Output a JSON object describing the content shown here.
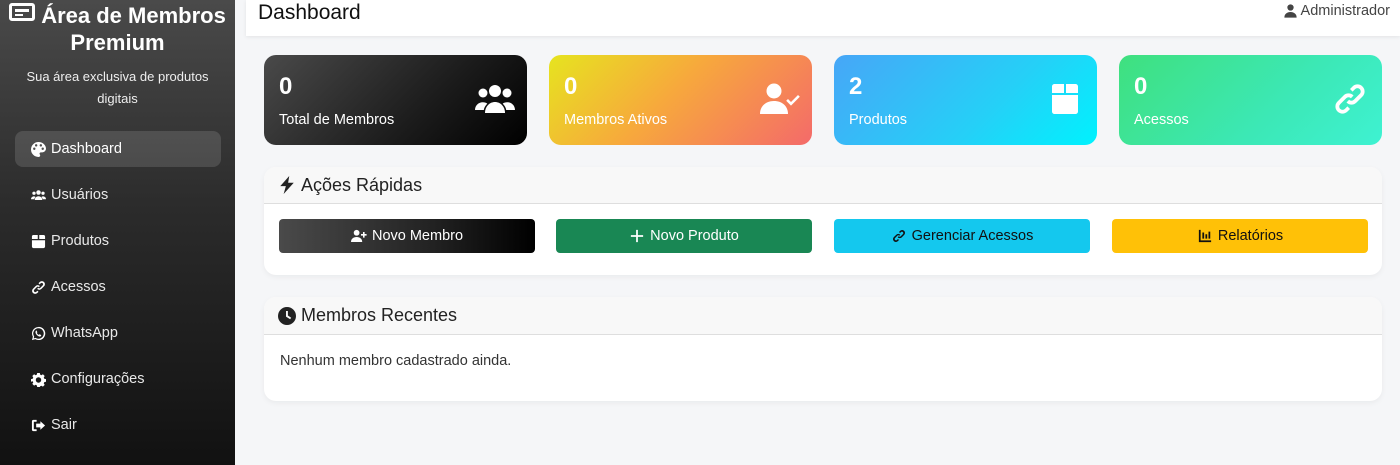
{
  "sidebar": {
    "brand_title": "Área de Membros Premium",
    "brand_subtitle": "Sua área exclusiva de produtos digitais",
    "items": [
      {
        "label": "Dashboard",
        "icon": "palette-icon",
        "active": true
      },
      {
        "label": "Usuários",
        "icon": "users-icon"
      },
      {
        "label": "Produtos",
        "icon": "box-icon"
      },
      {
        "label": "Acessos",
        "icon": "link-icon"
      },
      {
        "label": "WhatsApp",
        "icon": "whatsapp-icon"
      },
      {
        "label": "Configurações",
        "icon": "gear-icon"
      },
      {
        "label": "Sair",
        "icon": "sign-out-icon"
      }
    ]
  },
  "header": {
    "title": "Dashboard",
    "user": "Administrador"
  },
  "stats": [
    {
      "value": "0",
      "label": "Total de Membros",
      "icon": "users-icon"
    },
    {
      "value": "0",
      "label": "Membros Ativos",
      "icon": "user-check-icon"
    },
    {
      "value": "2",
      "label": "Produtos",
      "icon": "box-icon"
    },
    {
      "value": "0",
      "label": "Acessos",
      "icon": "link-icon"
    }
  ],
  "quick_actions": {
    "title": "Ações Rápidas",
    "buttons": [
      {
        "label": "Novo Membro",
        "icon": "user-plus-icon",
        "color": "#222222"
      },
      {
        "label": "Novo Produto",
        "icon": "plus-icon",
        "color": "#198754"
      },
      {
        "label": "Gerenciar Acessos",
        "icon": "link-icon",
        "color": "#14c8ee"
      },
      {
        "label": "Relatórios",
        "icon": "chart-icon",
        "color": "#ffc107"
      }
    ]
  },
  "recent_members": {
    "title": "Membros Recentes",
    "empty_message": "Nenhum membro cadastrado ainda."
  }
}
